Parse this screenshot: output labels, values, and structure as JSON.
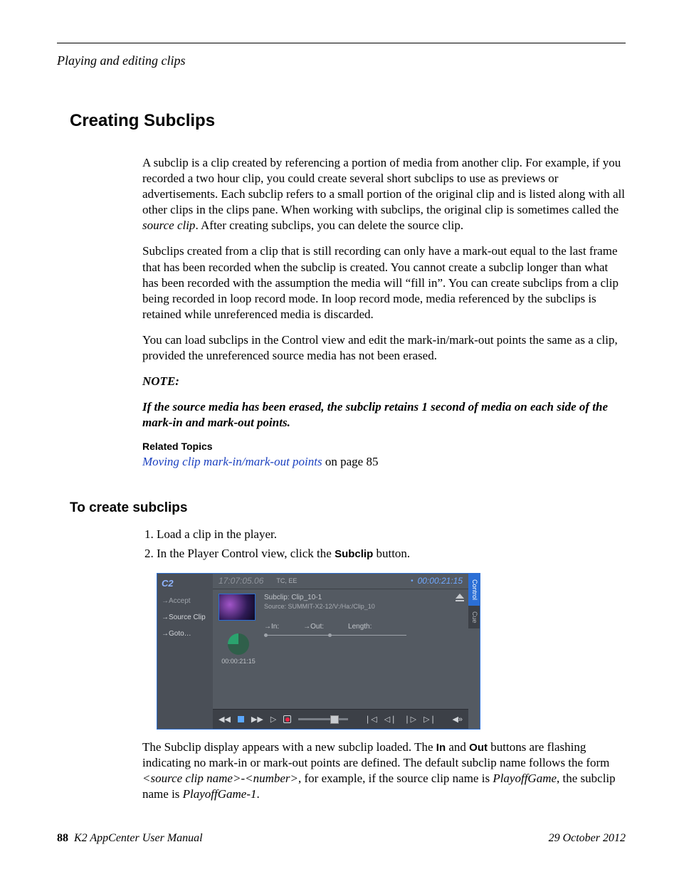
{
  "running_head": "Playing and editing clips",
  "h1": "Creating Subclips",
  "p1": "A subclip is a clip created by referencing a portion of media from another clip. For example, if you recorded a two hour clip, you could create several short subclips to use as previews or advertisements. Each subclip refers to a small portion of the original clip and is listed along with all other clips in the clips pane. When working with subclips, the original clip is sometimes called the ",
  "p1_em": "source clip",
  "p1_tail": ". After creating subclips, you can delete the source clip.",
  "p2": "Subclips created from a clip that is still recording can only have a mark-out equal to the last frame that has been recorded when the subclip is created. You cannot create a subclip longer than what has been recorded with the assumption the media will “fill in”. You can create subclips from a clip being recorded in loop record mode. In loop record mode, media referenced by the subclips is retained while unreferenced media is discarded.",
  "p3": "You can load subclips in the Control view and edit the mark-in/mark-out points the same as a clip, provided the unreferenced source media has not been erased.",
  "note_label": "NOTE:",
  "note_body": "If the source media has been erased, the subclip retains 1 second of media on each side of the mark-in and mark-out points.",
  "related_heading": "Related Topics",
  "related_link_text": "Moving clip mark-in/mark-out points",
  "related_link_tail": " on page 85",
  "h2": "To create subclips",
  "steps": {
    "s1": "Load a clip in the player.",
    "s2_a": "In the Player Control view, click the ",
    "s2_b": "Subclip",
    "s2_c": " button."
  },
  "shot": {
    "channel": "C2",
    "tc1": "17:07:05.06",
    "tcee": "TC, EE",
    "tc2": "00:00:21:15",
    "accept": "→Accept",
    "source_clip": "→Source Clip",
    "goto": "→Goto…",
    "subclip_label": "Subclip:",
    "subclip_name": "Clip_10-1",
    "source_label": "Source:",
    "source_path": "SUMMIT-X2-12/V:/Ha:/Clip_10",
    "in": "→In:",
    "out": "→Out:",
    "length": "Length:",
    "dur": "00:00:21:15",
    "tab_control": "Control",
    "tab_cue": "Cue",
    "rew": "◀◀",
    "ff": "▶▶",
    "play": "▷",
    "skip_start": "❘◁",
    "step_back": "◁❘",
    "step_fwd": "❘▷",
    "skip_end": "▷❘",
    "speaker": "◀»"
  },
  "after": {
    "a1": "The Subclip display appears with a new subclip loaded. The ",
    "in": "In",
    "a2": " and ",
    "out": "Out",
    "a3": " buttons are flashing indicating no mark-in or mark-out points are defined. The default subclip name follows the form ",
    "form": "<source clip name>-<number>",
    "a4": ", for example, if the source clip name is ",
    "ex1": "PlayoffGame",
    "a5": ", the subclip name is ",
    "ex2": "PlayoffGame-1",
    "a6": "."
  },
  "footer": {
    "page": "88",
    "manual": "K2 AppCenter User Manual",
    "date": "29 October 2012"
  }
}
